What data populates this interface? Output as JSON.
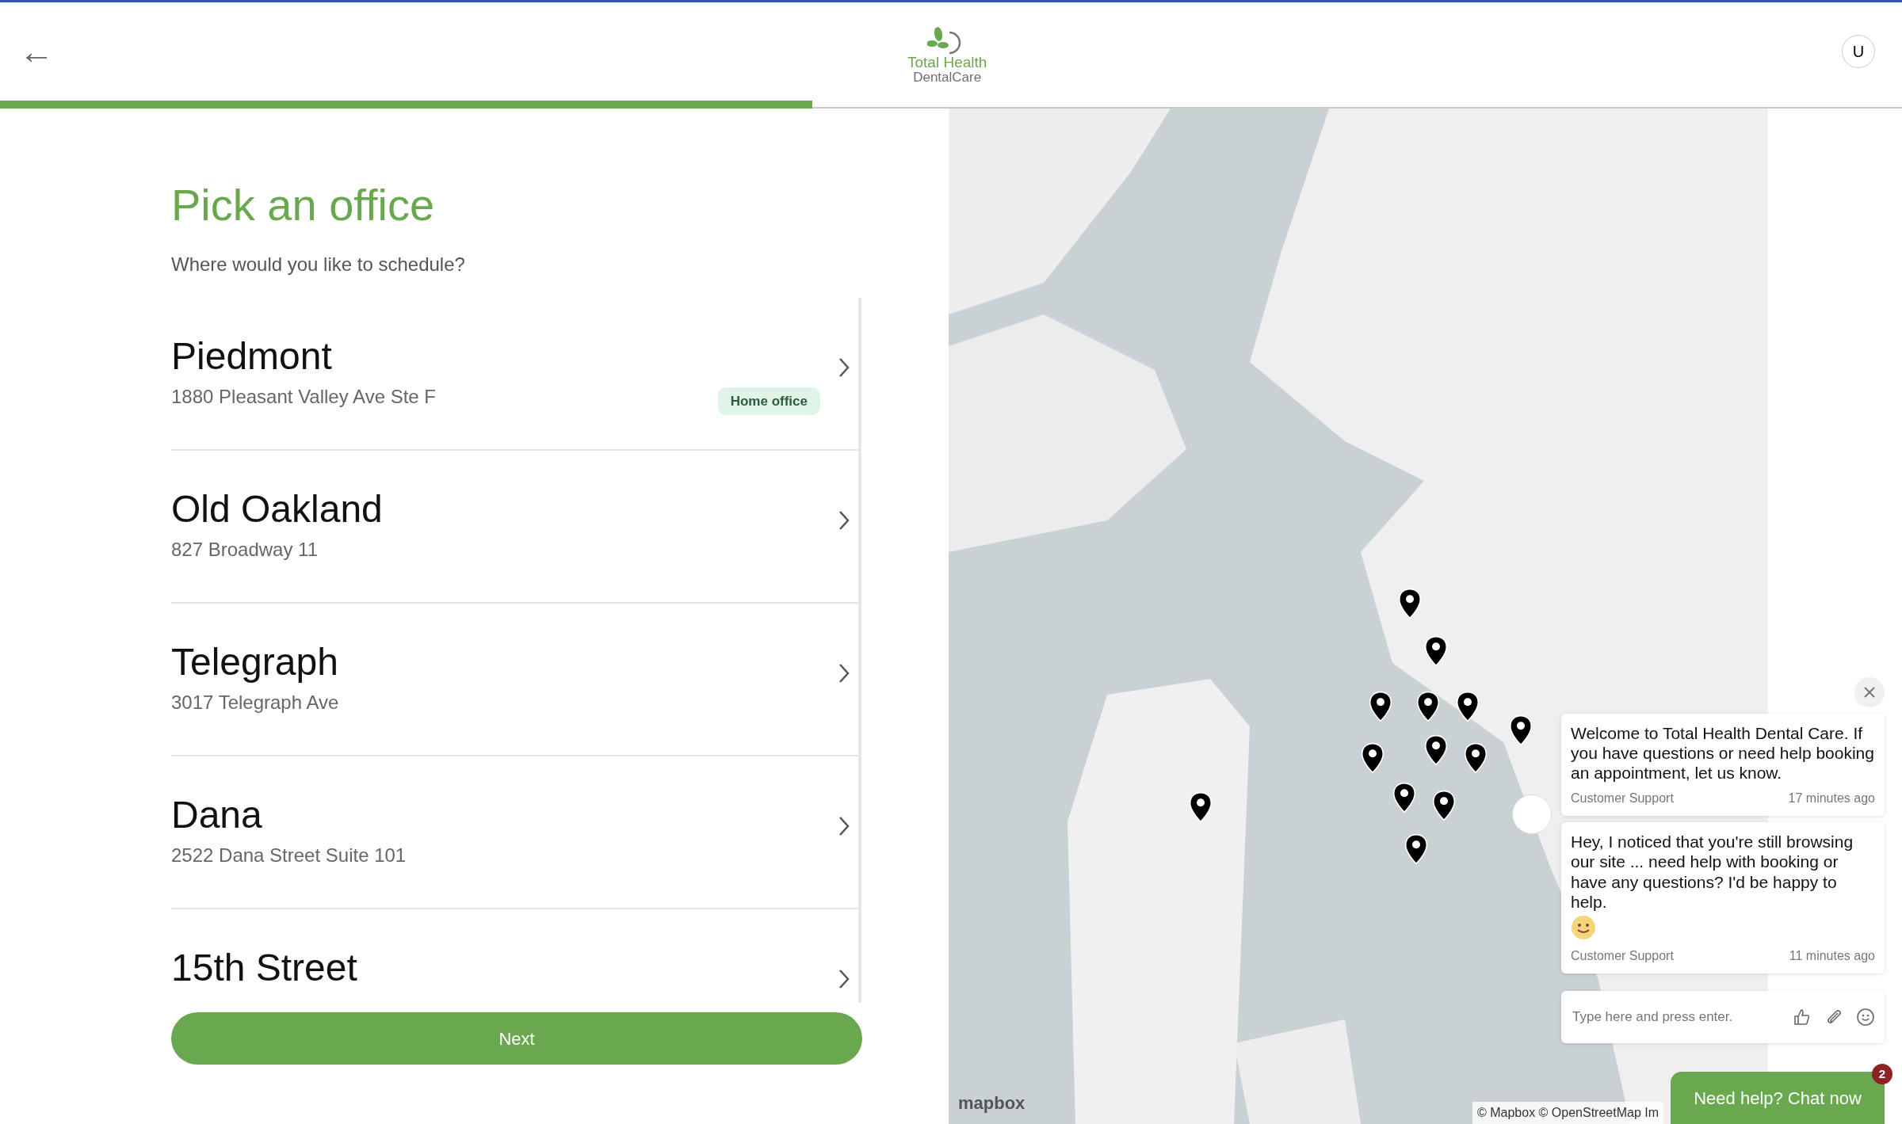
{
  "header": {
    "back": "←",
    "logo_line1": "Total Health",
    "logo_line2": "DentalCare",
    "avatar": "U"
  },
  "progress": {
    "level": 0.427
  },
  "heading": "Pick an office",
  "subheading": "Where would you like to schedule?",
  "offices": [
    {
      "name": "Piedmont",
      "address": "1880 Pleasant Valley Ave Ste F",
      "badge": "Home office"
    },
    {
      "name": "Old Oakland",
      "address": "827 Broadway 11"
    },
    {
      "name": "Telegraph",
      "address": "3017 Telegraph Ave"
    },
    {
      "name": "Dana",
      "address": "2522 Dana Street Suite 101"
    },
    {
      "name": "15th Street"
    }
  ],
  "next_button": "Next",
  "map": {
    "logo": "mapbox",
    "attribution": "© Mapbox © OpenStreetMap Im"
  },
  "chat": {
    "messages": [
      {
        "text": "Welcome to Total Health Dental Care. If you have questions or need help booking an appointment, let us know.",
        "author": "Customer Support",
        "time": "17 minutes ago",
        "emoji": false
      },
      {
        "text": "Hey, I noticed that you're still browsing our site ... need help with booking or have any questions? I'd be happy to help.",
        "author": "Customer Support",
        "time": "11 minutes ago",
        "emoji": true
      }
    ],
    "placeholder": "Type here and press enter.",
    "launcher": "Need help? Chat now",
    "unread": "2"
  }
}
